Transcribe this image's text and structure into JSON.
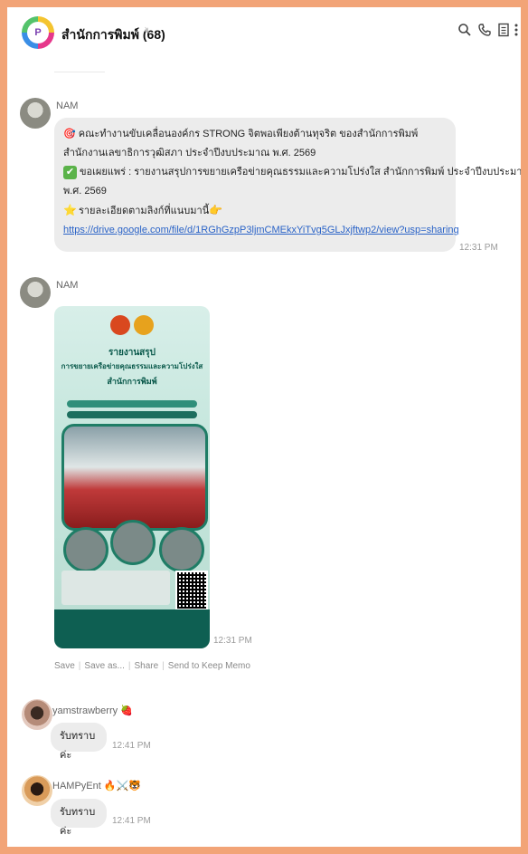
{
  "header": {
    "group_name": "สำนักการพิมพ์ (68)",
    "icons": [
      "search-icon",
      "phone-icon",
      "notes-icon",
      "more-icon"
    ]
  },
  "messages": [
    {
      "sender": "NAM",
      "lines": [
        "🎯 คณะทำงานขับเคลื่อนองค์กร STRONG จิตพอเพียงต้านทุจริต ของสำนักการพิมพ์",
        "สำนักงานเลขาธิการวุฒิสภา ประจำปีงบประมาณ พ.ศ. 2569",
        "ขอเผยแพร่ : รายงานสรุปการขยายเครือข่ายคุณธรรมและความโปร่งใส สำนักการพิมพ์ ประจำปีงบประมาณ",
        "พ.ศ. 2569",
        "รายละเอียดตามลิงก์ที่แนบมานี้"
      ],
      "link": "https://drive.google.com/file/d/1RGhGzpP3ljmCMEkxYiTvg5GLJxjftwp2/view?usp=sharing",
      "time": "12:31 PM"
    },
    {
      "sender": "NAM",
      "time": "12:31 PM",
      "poster": {
        "title_1": "รายงานสรุป",
        "title_2": "การขยายเครือข่ายคุณธรรมและความโปร่งใส",
        "title_3": "สำนักการพิมพ์"
      },
      "actions": [
        "Save",
        "Save as...",
        "Share",
        "Send to Keep Memo"
      ]
    },
    {
      "sender": "yamstrawberry 🍓",
      "text": "รับทราบค่ะ",
      "time": "12:41 PM"
    },
    {
      "sender": "HAMPyEnt 🔥⚔️🐯",
      "text": "รับทราบค่ะ",
      "time": "12:41 PM"
    }
  ]
}
